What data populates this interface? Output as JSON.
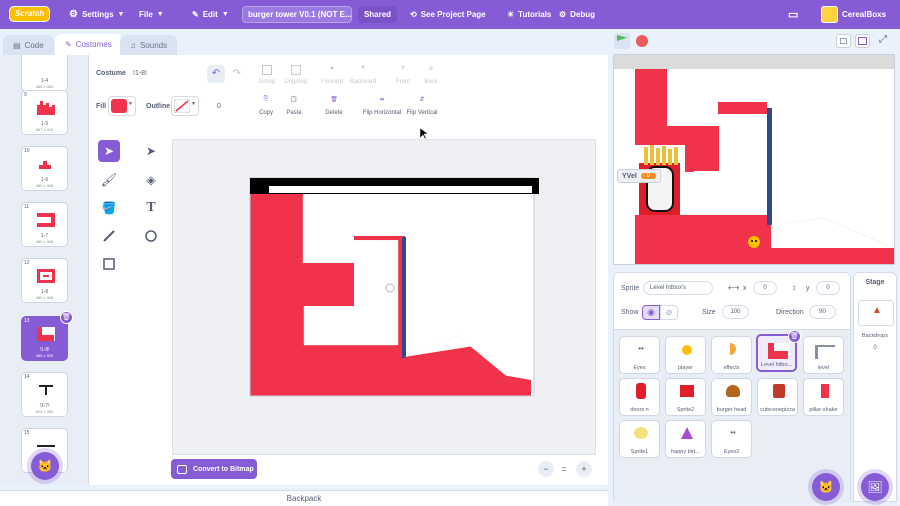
{
  "menubar": {
    "logo": "Scratch",
    "settings": "Settings",
    "file": "File",
    "edit": "Edit",
    "project_title": "burger tower V0.1 (NOT E...",
    "shared": "Shared",
    "see_project_page": "See Project Page",
    "tutorials": "Tutorials",
    "debug": "Debug",
    "username": "CerealBoxs"
  },
  "tabs": {
    "code": "Code",
    "costumes": "Costumes",
    "sounds": "Sounds"
  },
  "costumes": [
    {
      "num": "",
      "name": "1-4",
      "size": "480 x 360"
    },
    {
      "num": "9",
      "name": "1-5",
      "size": "667 x 410"
    },
    {
      "num": "10",
      "name": "1-6",
      "size": "480 x 306"
    },
    {
      "num": "11",
      "name": "1-7",
      "size": "480 x 306"
    },
    {
      "num": "12",
      "name": "1-8",
      "size": "480 x 306"
    },
    {
      "num": "13",
      "name": "!1-8!",
      "size": "480 x 320"
    },
    {
      "num": "14",
      "name": "!1-7!",
      "size": "625 x 480"
    },
    {
      "num": "15",
      "name": "",
      "size": ""
    }
  ],
  "editor": {
    "costume_label": "Costume",
    "costume_name": "!1-8!",
    "fill_label": "Fill",
    "outline_label": "Outline",
    "outline_width": "0",
    "fill_color": "#f0324b",
    "toolbar": {
      "group": "Group",
      "ungroup": "Ungroup",
      "forward": "Forward",
      "backward": "Backward",
      "front": "Front",
      "back": "Back",
      "copy": "Copy",
      "paste": "Paste",
      "delete": "Delete",
      "flip_h": "Flip Horizontal",
      "flip_v": "Flip Vertical"
    },
    "convert": "Convert to Bitmap",
    "zoom_reset": "="
  },
  "backpack": "Backpack",
  "stage": {
    "monitor_label": "YVel",
    "monitor_value": "0"
  },
  "sprite_info": {
    "sprite_label": "Sprite",
    "sprite_name": "Level hitbox's",
    "x_label": "x",
    "x": "0",
    "y_label": "y",
    "y": "0",
    "show_label": "Show",
    "size_label": "Size",
    "size": "100",
    "direction_label": "Direction",
    "direction": "90"
  },
  "sprites": [
    {
      "name": "Eyes"
    },
    {
      "name": "player"
    },
    {
      "name": "effects"
    },
    {
      "name": "Level hitbo..."
    },
    {
      "name": "level"
    },
    {
      "name": "doors n"
    },
    {
      "name": "Sprite2"
    },
    {
      "name": "burger head"
    },
    {
      "name": "cutscenepizza"
    },
    {
      "name": "pillar-shake"
    },
    {
      "name": "Sprite1"
    },
    {
      "name": "happy birt..."
    },
    {
      "name": "Eyes2"
    }
  ],
  "stage_pane": {
    "title": "Stage",
    "backdrops_label": "Backdrops",
    "backdrops_count": "0"
  },
  "colors": {
    "accent": "#855cd6",
    "level_red": "#f0324b",
    "level_blue": "#2d4b8c"
  }
}
